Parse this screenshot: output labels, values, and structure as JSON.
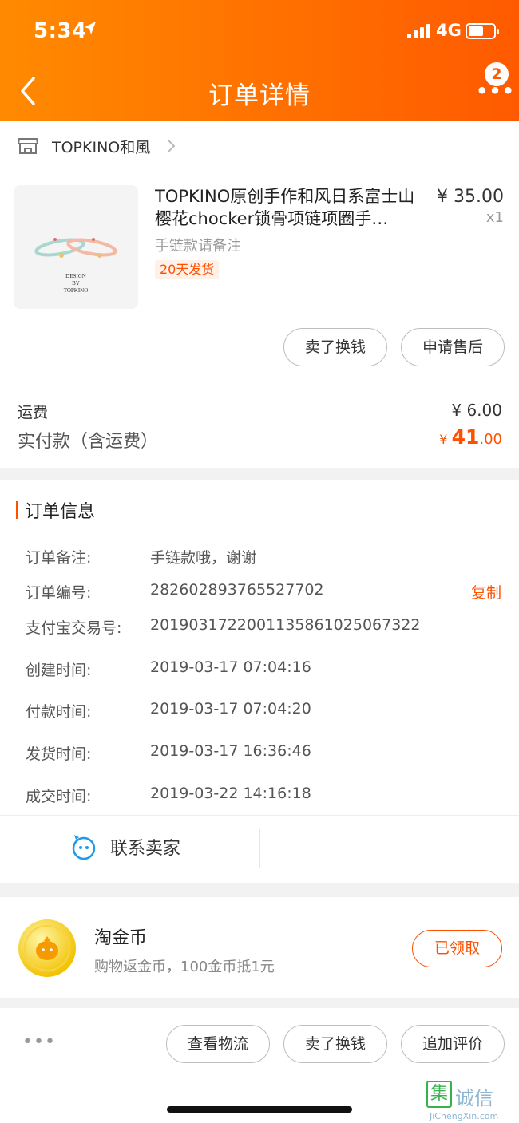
{
  "status_bar": {
    "time": "5:34",
    "network": "4G"
  },
  "header": {
    "title": "订单详情",
    "more_glyph": "•••",
    "badge": "2"
  },
  "shop": {
    "name": "TOPKINO和風"
  },
  "product": {
    "thumb_brand": "DESIGN\nBY\nTOPKINO",
    "title": "TOPKINO原创手作和风日系富士山樱花chocker锁骨项链项圈手…",
    "price": "¥ 35.00",
    "qty": "x1",
    "spec": "手链款请备注",
    "ship_tag": "20天发货",
    "buttons": [
      "卖了换钱",
      "申请售后"
    ]
  },
  "fee": {
    "shipping_label": "运费",
    "shipping_value": "¥ 6.00",
    "paid_label": "实付款（含运费）",
    "paid_currency": "¥",
    "paid_int": "41",
    "paid_dec": ".00"
  },
  "order_info": {
    "title": "订单信息",
    "rows": [
      {
        "k": "订单备注:",
        "v": "手链款哦，谢谢"
      },
      {
        "k": "订单编号:",
        "v": "282602893765527702",
        "action": "复制"
      },
      {
        "k": "支付宝交易号:",
        "v": "2019031722001135861025067322"
      },
      {
        "k": "创建时间:",
        "v": "2019-03-17 07:04:16"
      },
      {
        "k": "付款时间:",
        "v": "2019-03-17 07:04:20"
      },
      {
        "k": "发货时间:",
        "v": "2019-03-17 16:36:46"
      },
      {
        "k": "成交时间:",
        "v": "2019-03-22 14:16:18"
      }
    ],
    "contact_label": "联系卖家"
  },
  "coins": {
    "title": "淘金币",
    "desc": "购物返金币，100金币抵1元",
    "button": "已领取"
  },
  "bottom_bar": {
    "more_glyph": "•••",
    "buttons": [
      "查看物流",
      "卖了换钱",
      "追加评价"
    ]
  },
  "watermark": {
    "glyph": "集",
    "title": "诚信",
    "url": "JiChengXin.com"
  },
  "colors": {
    "accent": "#ff5000",
    "header_start": "#ff8a00",
    "header_end": "#ff5a00"
  },
  "icons": [
    "location-arrow-icon",
    "signal-icon",
    "battery-icon",
    "back-icon",
    "more-icon",
    "shop-icon",
    "chevron-right-icon",
    "contact-seller-icon",
    "gold-coin-icon"
  ]
}
